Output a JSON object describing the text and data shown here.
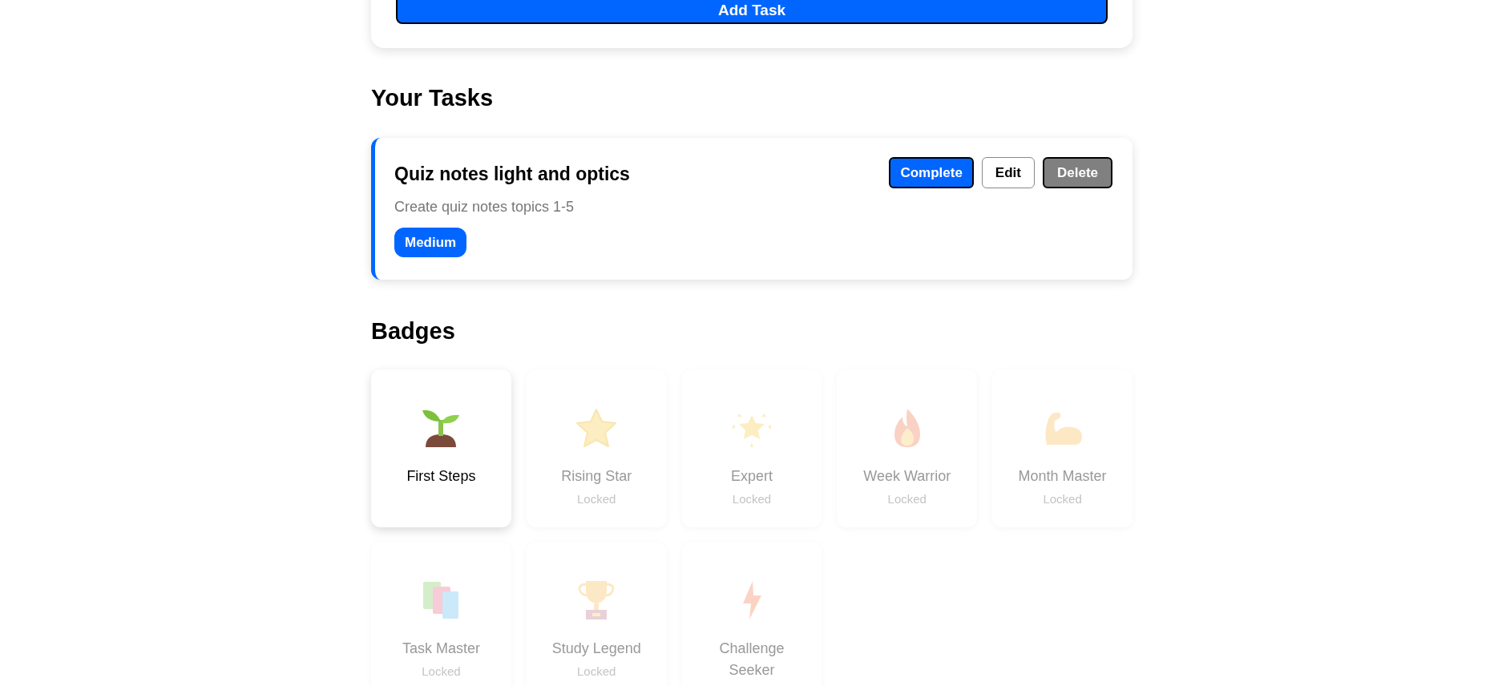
{
  "add_task_button": {
    "label": "Add Task"
  },
  "tasks_section": {
    "heading": "Your Tasks",
    "tasks": [
      {
        "title": "Quiz notes light and optics",
        "description": "Create quiz notes topics 1-5",
        "priority": "Medium",
        "color": "#0066ff",
        "actions": [
          {
            "kind": "primary",
            "label": "Complete"
          },
          {
            "kind": "outline",
            "label": "Edit"
          },
          {
            "kind": "danger",
            "label": "Delete"
          }
        ]
      }
    ]
  },
  "badges_section": {
    "heading": "Badges",
    "badges": [
      {
        "name": "First Steps",
        "unlocked": true
      },
      {
        "name": "Rising Star",
        "unlocked": false,
        "status": "Locked"
      },
      {
        "name": "Expert",
        "unlocked": false,
        "status": "Locked"
      },
      {
        "name": "Week Warrior",
        "unlocked": false,
        "status": "Locked"
      },
      {
        "name": "Month Master",
        "unlocked": false,
        "status": "Locked"
      },
      {
        "name": "Task Master",
        "unlocked": false,
        "status": "Locked"
      },
      {
        "name": "Study Legend",
        "unlocked": false,
        "status": "Locked"
      },
      {
        "name": "Challenge Seeker",
        "unlocked": false
      }
    ]
  }
}
